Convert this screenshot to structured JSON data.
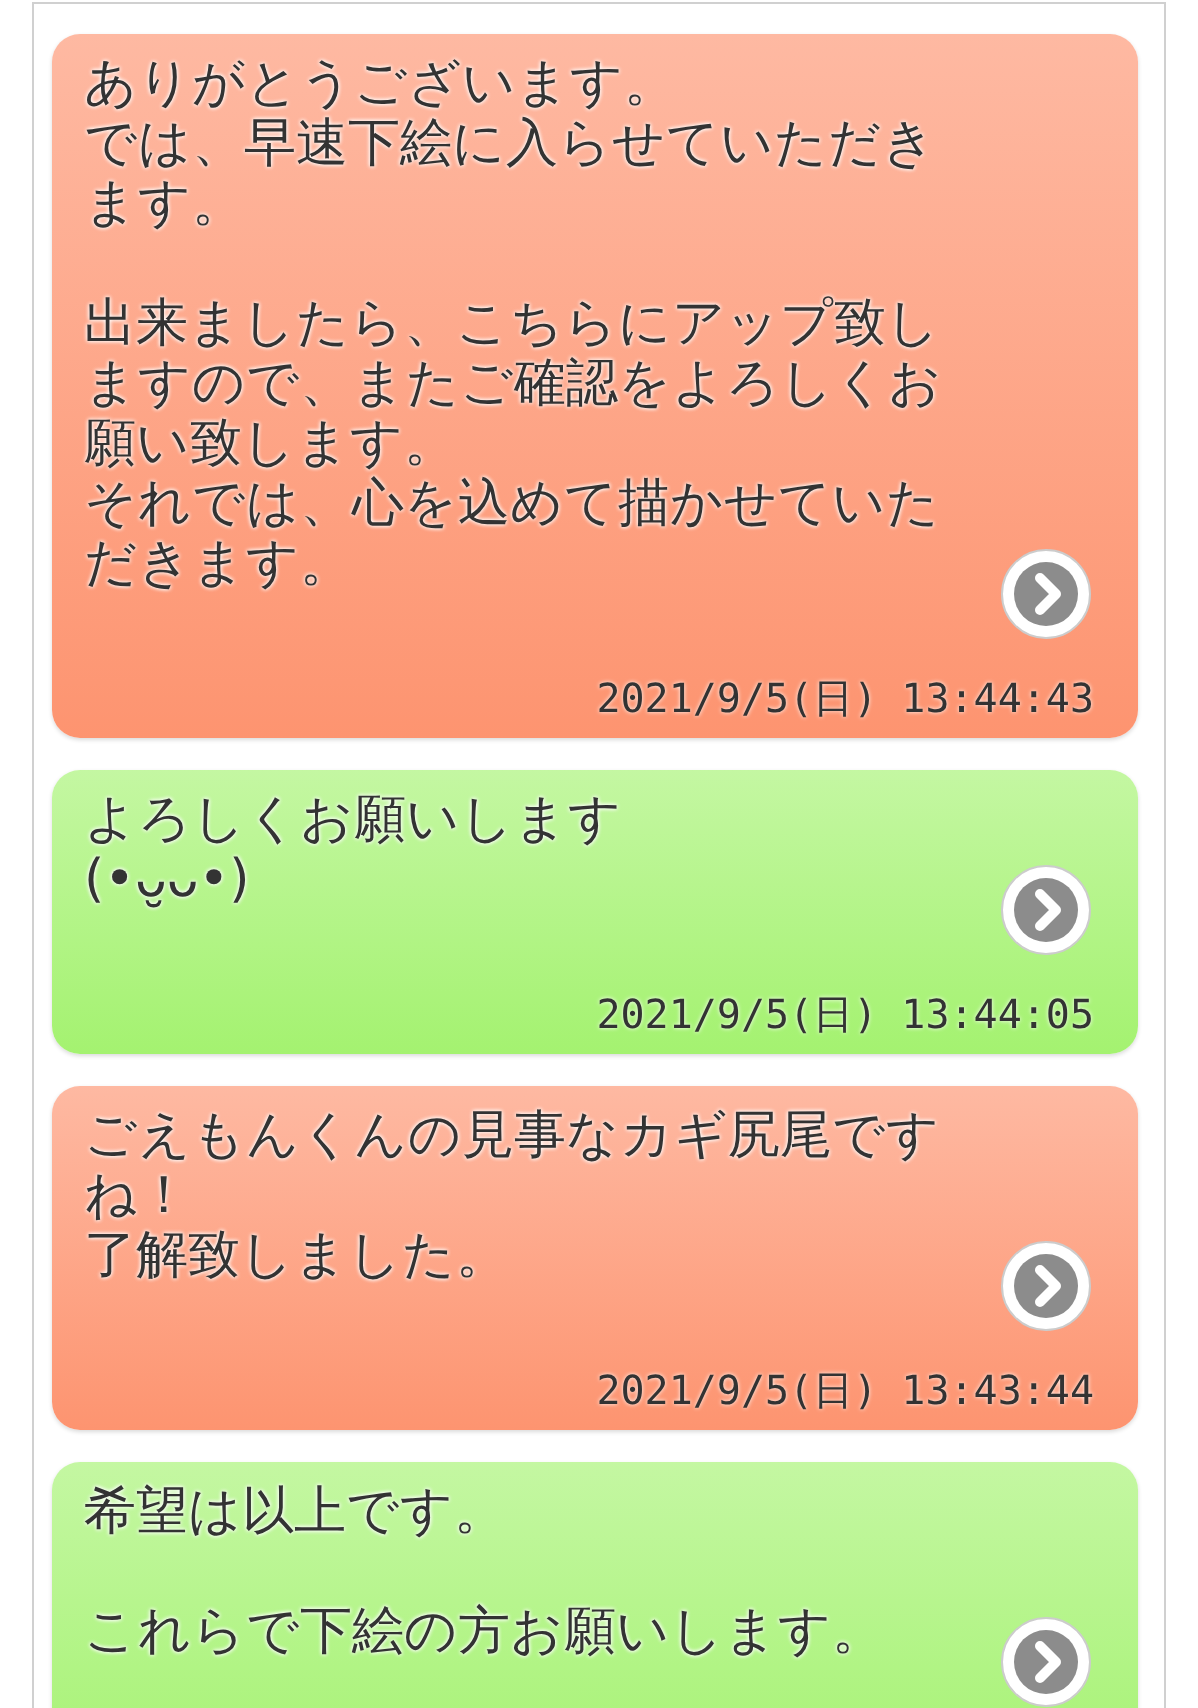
{
  "messages": [
    {
      "color": "#fd9470",
      "paragraphs": [
        [
          "ありがとうございます。",
          "では、早速下絵に入らせていただき",
          "ます。"
        ],
        [
          "出来ましたら、こちらにアップ致し",
          "ますので、またご確認をよろしくお",
          "願い致します。",
          "それでは、心を込めて描かせていた",
          "だきます。"
        ]
      ],
      "timestamp": "2021/9/5(日) 13:44:43"
    },
    {
      "color": "#a4f270",
      "paragraphs": [
        [
          "よろしくお願いします",
          "(•ᴗ̮ᴗ•)"
        ]
      ],
      "timestamp": "2021/9/5(日) 13:44:05"
    },
    {
      "color": "#fd9470",
      "paragraphs": [
        [
          "ごえもんくんの見事なカギ尻尾です",
          "ね！",
          "了解致しました。"
        ]
      ],
      "timestamp": "2021/9/5(日) 13:43:44"
    },
    {
      "color": "#a4f270",
      "paragraphs": [
        [
          "希望は以上です。"
        ],
        [
          "これらで下絵の方お願いします。"
        ]
      ]
    }
  ]
}
